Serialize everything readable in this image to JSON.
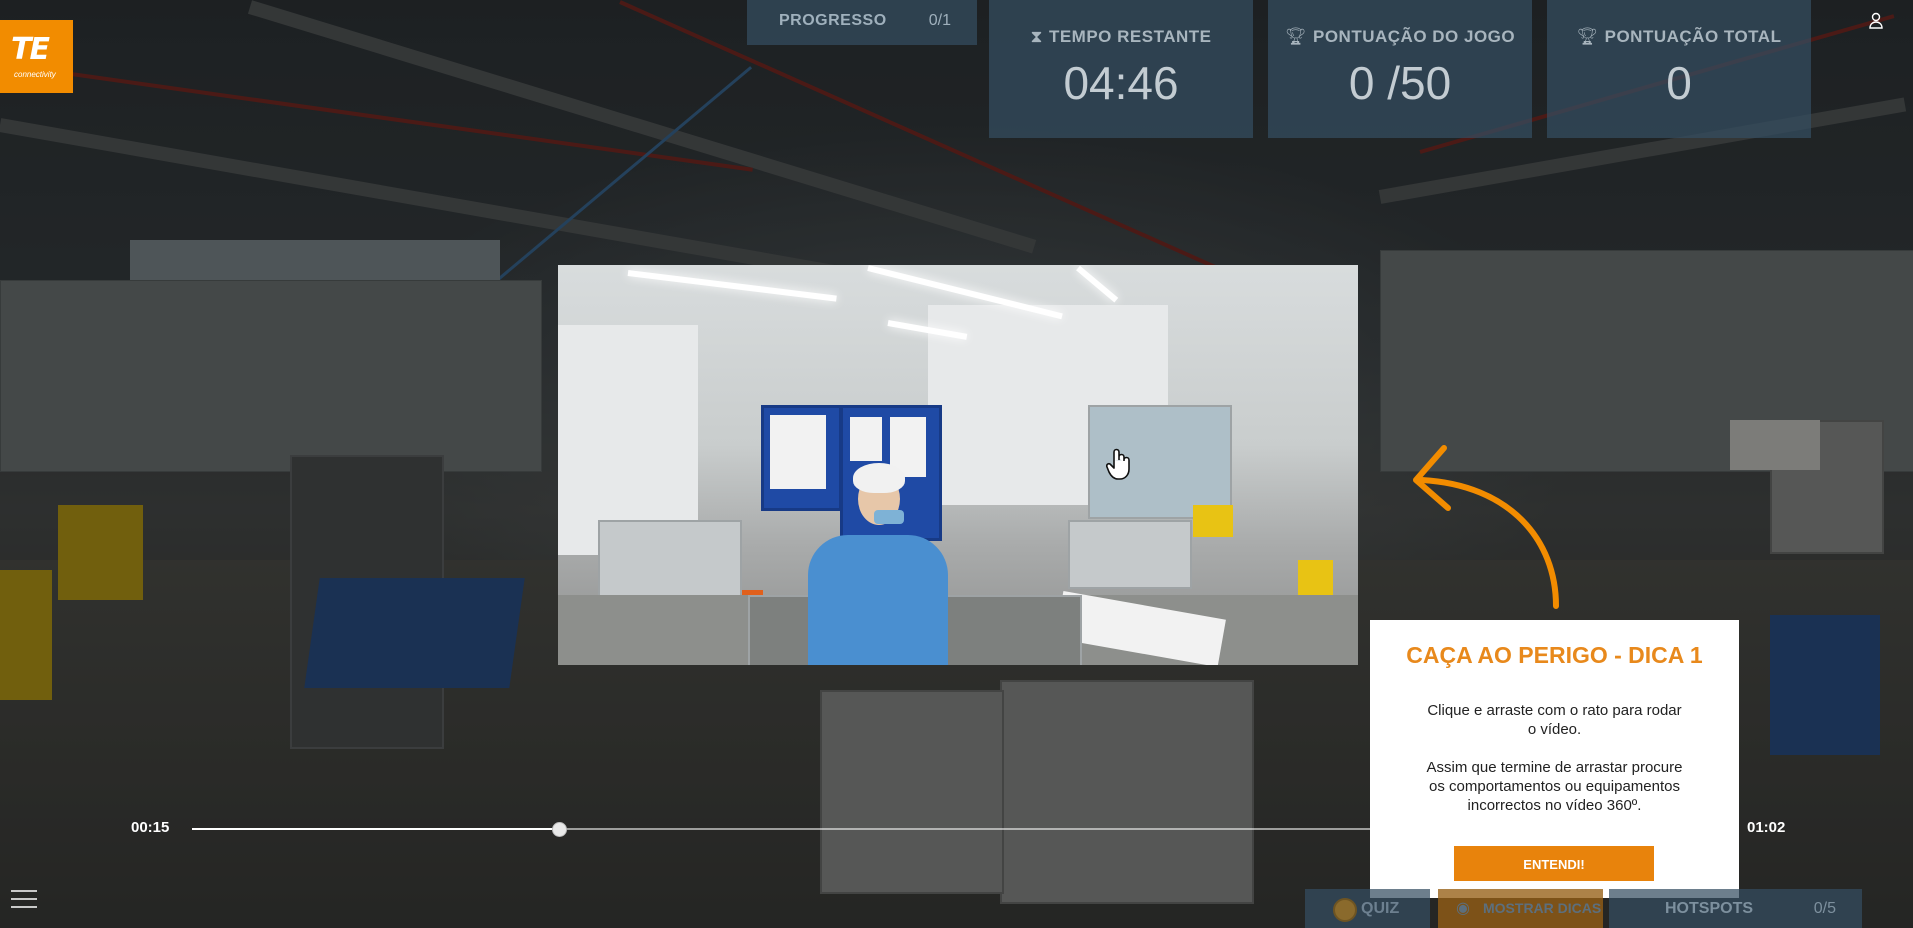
{
  "logo": {
    "mark": "TE",
    "tagline": "connectivity"
  },
  "progress": {
    "label": "PROGRESSO",
    "value": "0/1"
  },
  "stats": [
    {
      "icon": "hourglass-icon",
      "label": "TEMPO RESTANTE",
      "value": "04:46"
    },
    {
      "icon": "trophy-icon",
      "label": "PONTUAÇÃO DO JOGO",
      "value": "0 /50"
    },
    {
      "icon": "trophy-icon",
      "label": "PONTUAÇÃO TOTAL",
      "value": "0"
    }
  ],
  "player": {
    "current_time": "00:15",
    "duration": "01:02",
    "progress": 0.24
  },
  "hint": {
    "title": "CAÇA AO PERIGO - DICA 1",
    "body": "Clique e arraste com o rato para rodar\no vídeo.\n\nAssim que termine de arrastar procure\nos comportamentos ou equipamentos\nincorrectos no vídeo 360º.",
    "button": "ENTENDI!"
  },
  "bottom_bar": {
    "quiz": "QUIZ",
    "show_hints": "MOSTRAR DICAS",
    "hotspots_label": "HOTSPOTS",
    "hotspots_value": "0/5"
  },
  "colors": {
    "accent": "#e8830c",
    "hud_panel": "#344d61",
    "logo": "#f28c00"
  }
}
